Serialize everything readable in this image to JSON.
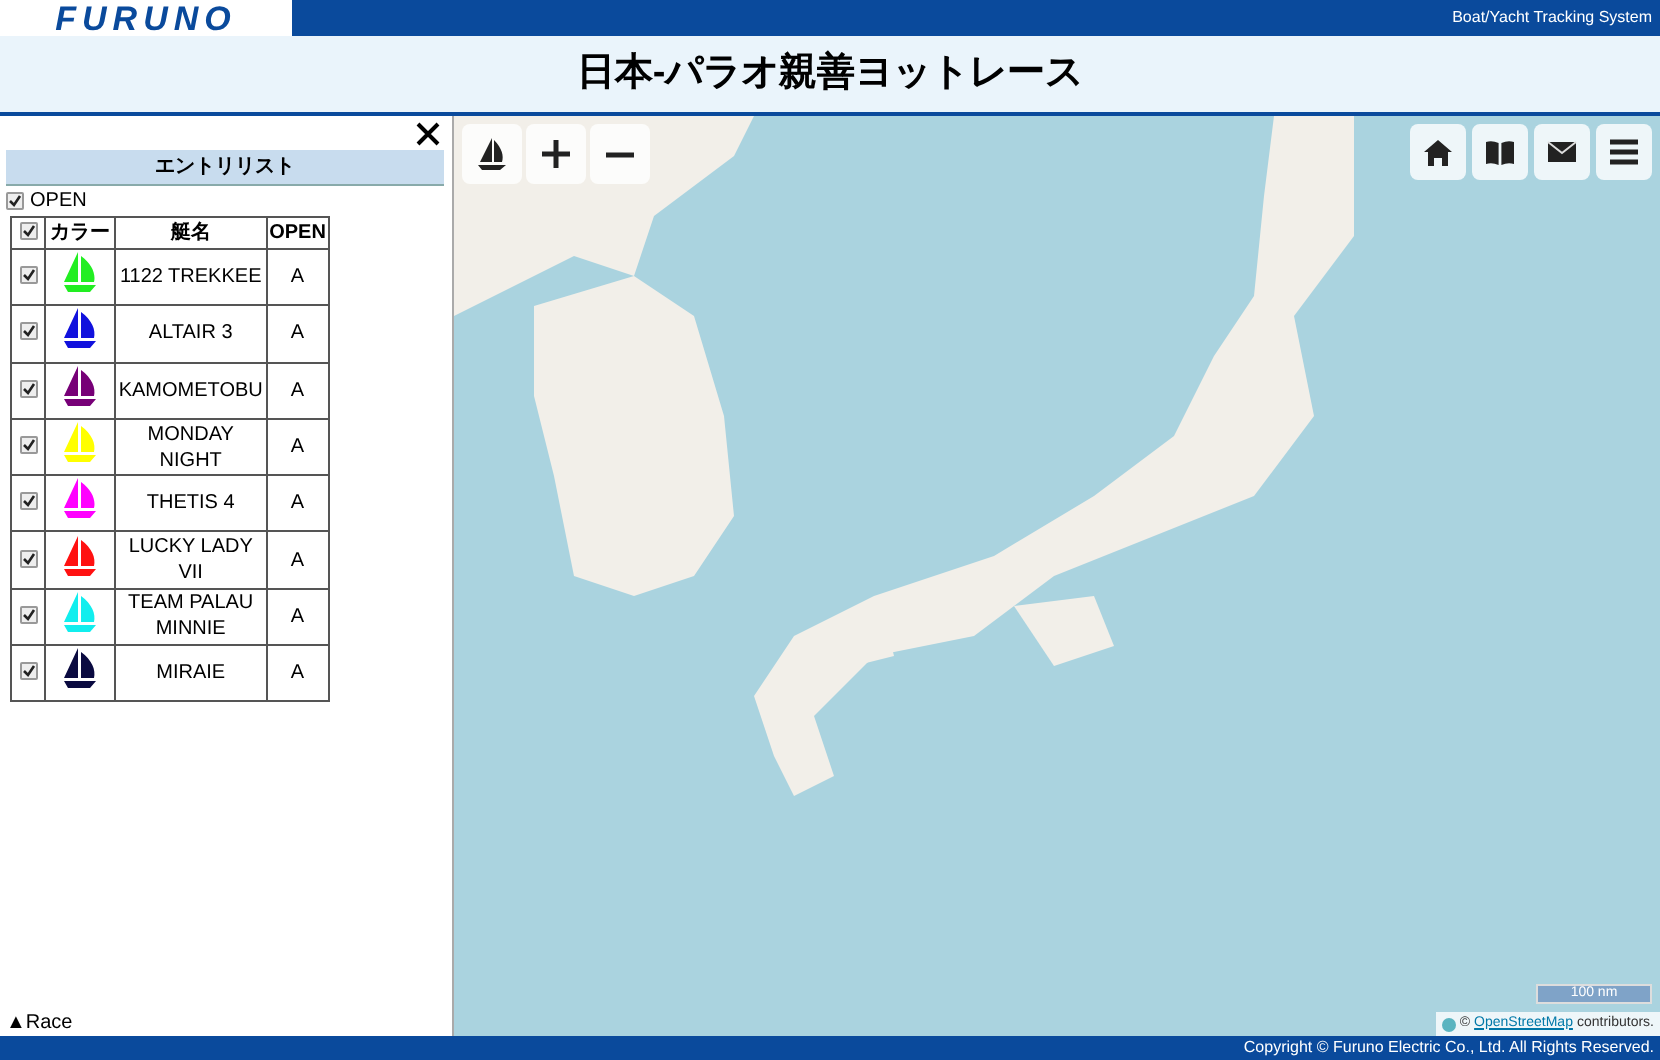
{
  "header": {
    "logo": "FURUNO",
    "system_name": "Boat/Yacht Tracking System",
    "title": "日本-パラオ親善ヨットレース"
  },
  "entry_panel": {
    "title": "エントリリスト",
    "open_filter": {
      "label": "OPEN",
      "checked": true
    },
    "table": {
      "all_checked": true,
      "columns": [
        "カラー",
        "艇名",
        "OPEN"
      ],
      "rows": [
        {
          "checked": true,
          "color": "#22ee22",
          "name": "1122 TREKKEE",
          "class": "A"
        },
        {
          "checked": true,
          "color": "#1111dd",
          "name": "ALTAIR 3",
          "class": "A"
        },
        {
          "checked": true,
          "color": "#770077",
          "name": "KAMOMETOBU",
          "class": "A"
        },
        {
          "checked": true,
          "color": "#ffff00",
          "name": "MONDAY NIGHT",
          "class": "A"
        },
        {
          "checked": true,
          "color": "#ff00ff",
          "name": "THETIS 4",
          "class": "A"
        },
        {
          "checked": true,
          "color": "#ff1111",
          "name": "LUCKY LADY VII",
          "class": "A"
        },
        {
          "checked": true,
          "color": "#11eeee",
          "name": "TEAM PALAU MINNIE",
          "class": "A"
        },
        {
          "checked": true,
          "color": "#0a0a40",
          "name": "MIRAIE",
          "class": "A"
        }
      ]
    },
    "race_toggle": "▲Race"
  },
  "map": {
    "scale": "100 nm",
    "attribution": {
      "prefix": "©",
      "link": "OpenStreetMap",
      "suffix": "contributors."
    }
  },
  "footer": "Copyright © Furuno Electric Co., Ltd. All Rights Reserved."
}
